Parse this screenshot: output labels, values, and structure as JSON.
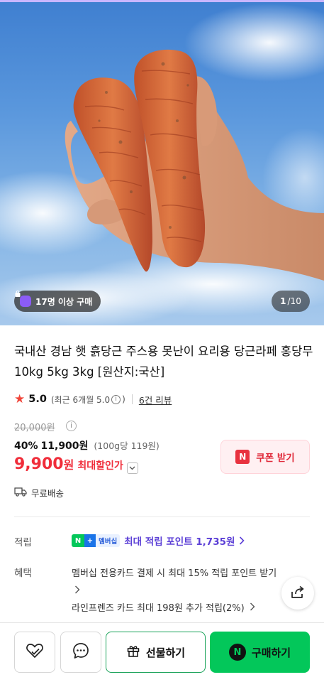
{
  "hero": {
    "buyer_badge": "17명 이상 구매",
    "counter_current": "1",
    "counter_total": "/10"
  },
  "product": {
    "title": "국내산 경남 햇 흙당근 주스용 못난이 요리용 당근라페 홍당무 10kg 5kg 3kg [원산지:국산]",
    "rating": "5.0",
    "rating_recent": "(최근 6개월 5.0",
    "rating_recent_close": ")",
    "review_count": "6건 리뷰",
    "original_price": "20,000원",
    "discount_rate": "40%",
    "sale_price": "11,900원",
    "unit_price": "(100g당 119원)",
    "max_discount_price": "9,900",
    "max_discount_won": "원",
    "max_discount_label": "최대할인가",
    "coupon_label": "쿠폰 받기",
    "shipping": "무료배송"
  },
  "benefits": {
    "points_label": "적립",
    "membership_badge": "멤버십",
    "points_text": "최대 적립 포인트 1,735원",
    "benefit_label": "혜택",
    "benefit_1": "멤버십 전용카드 결제 시 최대 15% 적립 포인트 받기",
    "benefit_2": "라인프렌즈 카드 최대 198원 추가 적립(2%)"
  },
  "bottom_bar": {
    "gift_label": "선물하기",
    "buy_label": "구매하기"
  },
  "colors": {
    "naver_green": "#03c75a",
    "price_red": "#f02d3a",
    "points_purple": "#5b3fd6"
  }
}
